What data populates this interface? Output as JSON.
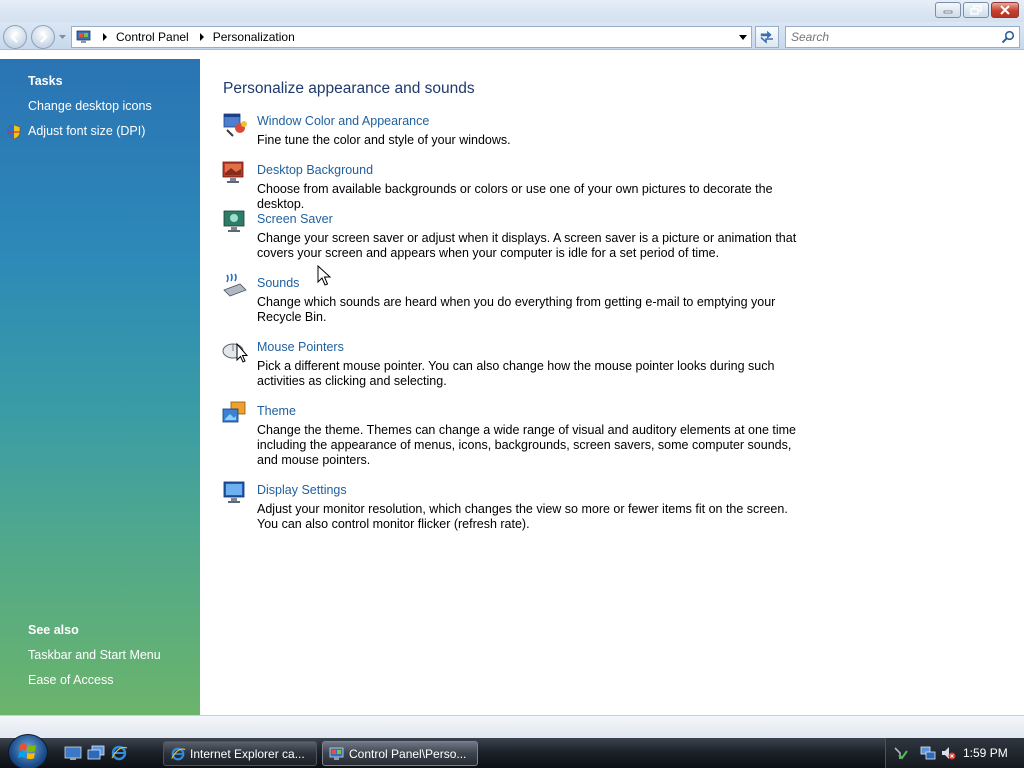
{
  "window": {
    "controls": {
      "minimize": "minimize-icon",
      "maximize": "restore-icon",
      "close": "close-icon"
    }
  },
  "address": {
    "breadcrumbs": [
      "Control Panel",
      "Personalization"
    ],
    "search_placeholder": "Search"
  },
  "sidebar": {
    "tasks_heading": "Tasks",
    "tasks": [
      {
        "label": "Change desktop icons",
        "icon": ""
      },
      {
        "label": "Adjust font size (DPI)",
        "icon": "shield-icon"
      }
    ],
    "see_also_heading": "See also",
    "see_also": [
      {
        "label": "Taskbar and Start Menu"
      },
      {
        "label": "Ease of Access"
      }
    ]
  },
  "main": {
    "title": "Personalize appearance and sounds",
    "items": [
      {
        "title": "Window Color and Appearance",
        "icon": "window-color-icon",
        "description": "Fine tune the color and style of your windows."
      },
      {
        "title": "Desktop Background",
        "icon": "desktop-background-icon",
        "description": "Choose from available backgrounds or colors or use one of your own pictures to decorate the desktop."
      },
      {
        "title": "Screen Saver",
        "icon": "screen-saver-icon",
        "description": "Change your screen saver or adjust when it displays. A screen saver is a picture or animation that covers your screen and appears when your computer is idle for a set period of time."
      },
      {
        "title": "Sounds",
        "icon": "sounds-icon",
        "description": "Change which sounds are heard when you do everything from getting e-mail to emptying your Recycle Bin."
      },
      {
        "title": "Mouse Pointers",
        "icon": "mouse-pointers-icon",
        "description": "Pick a different mouse pointer. You can also change how the mouse pointer looks during such activities as clicking and selecting."
      },
      {
        "title": "Theme",
        "icon": "theme-icon",
        "description": "Change the theme. Themes can change a wide range of visual and auditory elements at one time including the appearance of menus, icons, backgrounds, screen savers, some computer sounds, and mouse pointers."
      },
      {
        "title": "Display Settings",
        "icon": "display-settings-icon",
        "description": "Adjust your monitor resolution, which changes the view so more or fewer items fit on the screen. You can also control monitor flicker (refresh rate)."
      }
    ]
  },
  "taskbar": {
    "tasks": [
      {
        "label": "Internet Explorer ca...",
        "icon": "internet-explorer-icon",
        "active": false
      },
      {
        "label": "Control Panel\\Perso...",
        "icon": "control-panel-icon",
        "active": true
      }
    ],
    "clock": "1:59 PM"
  },
  "colors": {
    "link": "#1f5f9e",
    "title": "#1e3a6e",
    "pane_top": "#2a74b4",
    "pane_bottom": "#6bb46b"
  }
}
